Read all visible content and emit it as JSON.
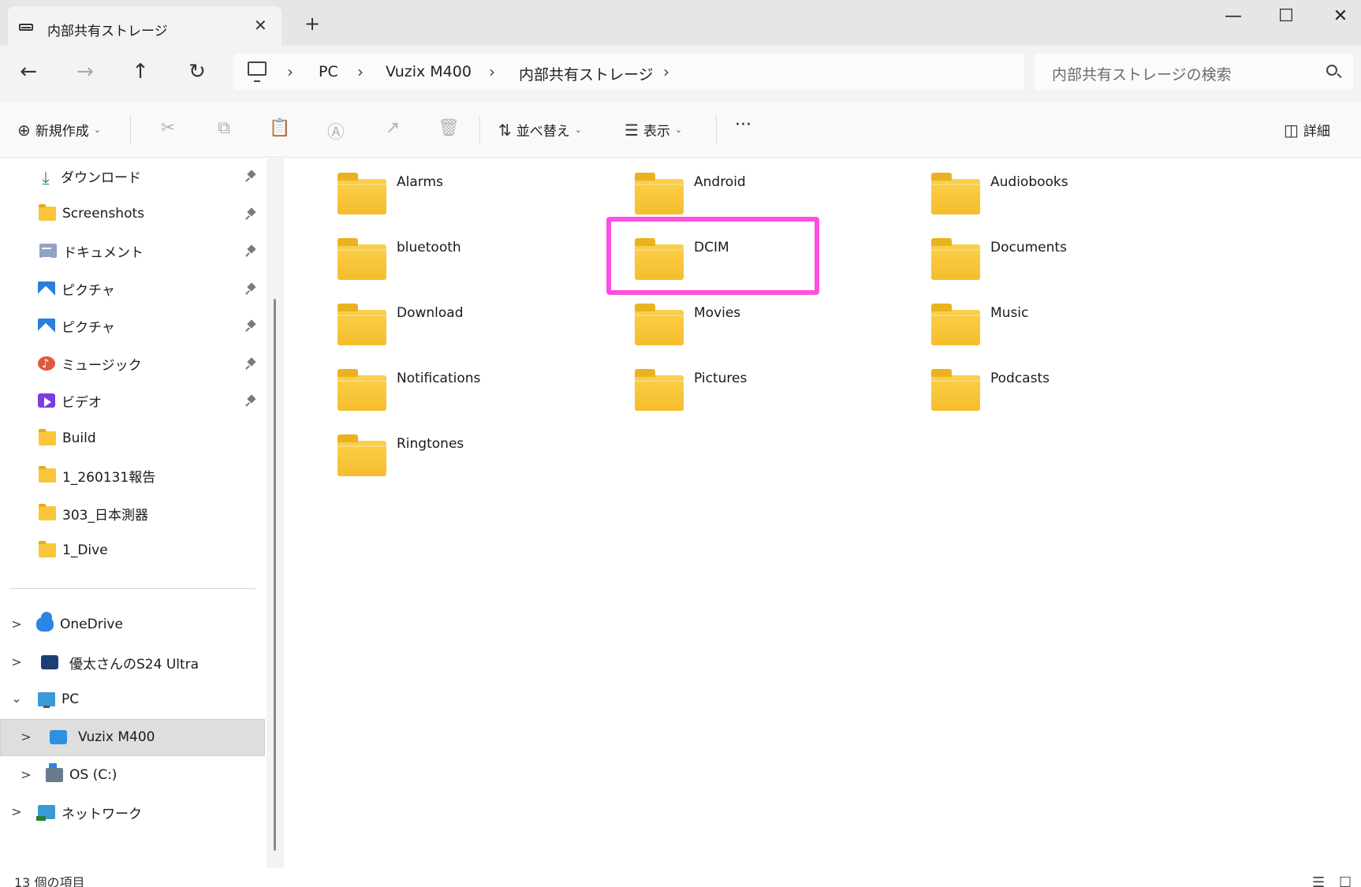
{
  "tab": {
    "title": "内部共有ストレージ",
    "close": "✕",
    "new": "+"
  },
  "window": {
    "minimize": "—",
    "maximize": "☐",
    "close": "✕"
  },
  "nav": {
    "back": "←",
    "forward": "→",
    "up": "↑",
    "refresh": "↻"
  },
  "breadcrumb": [
    "PC",
    "Vuzix M400",
    "内部共有ストレージ"
  ],
  "breadcrumb_sep": "›",
  "search": {
    "placeholder": "内部共有ストレージの検索"
  },
  "toolbar": {
    "new_label": "新規作成",
    "sort_label": "並べ替え",
    "view_label": "表示",
    "more_label": "···",
    "details_label": "詳細",
    "cut_icon": "✂",
    "copy_icon": "⧉",
    "paste_icon": "📋",
    "rename_icon": "Ⓐ",
    "share_icon": "↗",
    "delete_icon": "🗑"
  },
  "sidebar": {
    "quick_access": [
      {
        "label": "ダウンロード",
        "icon": "download-icon",
        "pinned": true
      },
      {
        "label": "Screenshots",
        "icon": "folder-icon",
        "pinned": true
      },
      {
        "label": "ドキュメント",
        "icon": "document-icon",
        "pinned": true
      },
      {
        "label": "ピクチャ",
        "icon": "pictures-icon",
        "pinned": true
      },
      {
        "label": "ピクチャ",
        "icon": "pictures-icon",
        "pinned": true
      },
      {
        "label": "ミュージック",
        "icon": "music-icon",
        "pinned": true
      },
      {
        "label": "ビデオ",
        "icon": "video-icon",
        "pinned": true
      },
      {
        "label": "Build",
        "icon": "folder-icon",
        "pinned": false
      },
      {
        "label": "1_260131報告",
        "icon": "folder-icon",
        "pinned": false
      },
      {
        "label": "303_日本測器",
        "icon": "folder-icon",
        "pinned": false
      },
      {
        "label": "1_Dive",
        "icon": "folder-icon",
        "pinned": false
      }
    ],
    "tree": [
      {
        "label": "OneDrive",
        "icon": "cloud-icon",
        "expander": ">"
      },
      {
        "label": "優太さんのS24 Ultra",
        "icon": "phone-icon",
        "expander": ">"
      },
      {
        "label": "PC",
        "icon": "monitor-icon",
        "expander": "⌄"
      },
      {
        "label": "Vuzix M400",
        "icon": "phone-icon",
        "expander": ">",
        "selected": true
      },
      {
        "label": "OS (C:)",
        "icon": "drive-icon",
        "expander": ">"
      },
      {
        "label": "ネットワーク",
        "icon": "network-icon",
        "expander": ">"
      }
    ]
  },
  "folders": [
    "Alarms",
    "Android",
    "Audiobooks",
    "bluetooth",
    "DCIM",
    "Documents",
    "Download",
    "Movies",
    "Music",
    "Notifications",
    "Pictures",
    "Podcasts",
    "Ringtones"
  ],
  "highlighted_folder": "DCIM",
  "highlight_color": "#ff4fe1",
  "status": {
    "item_count": "13 個の項目"
  }
}
